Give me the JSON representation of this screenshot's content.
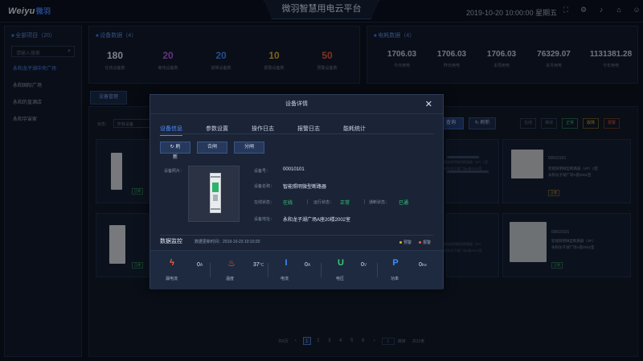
{
  "header": {
    "logo_text": "Weiyu",
    "logo_cn": "微羽",
    "title": "微羽智慧用电云平台",
    "datetime": "2019-10-20  10:00:00  星期五",
    "icons": [
      "fullscreen-icon",
      "settings-icon",
      "bell-icon",
      "home-icon",
      "user-icon"
    ]
  },
  "sidebar": {
    "title": "全部项目（20）",
    "search_placeholder": "请输入搜索",
    "items": [
      {
        "label": "永和龙子湖中央广场",
        "active": true
      },
      {
        "label": "永和国际广场",
        "active": false
      },
      {
        "label": "永和的皇酒店",
        "active": false
      },
      {
        "label": "永和宇宙家",
        "active": false
      }
    ]
  },
  "device_panel": {
    "title": "设备数据（4）",
    "stats": [
      {
        "value": "180",
        "label": "在线设备数",
        "color": "#e6edf7"
      },
      {
        "value": "20",
        "label": "离线设备数",
        "color": "#b45ee8"
      },
      {
        "value": "20",
        "label": "故障设备数",
        "color": "#3f8cff"
      },
      {
        "value": "10",
        "label": "报警设备数",
        "color": "#e7b22e"
      },
      {
        "value": "50",
        "label": "预警设备数",
        "color": "#ef5e3f"
      }
    ]
  },
  "energy_panel": {
    "title": "电耗数据（4）",
    "stats": [
      {
        "value": "1706.03",
        "label": "今日用电"
      },
      {
        "value": "1706.03",
        "label": "昨日用电"
      },
      {
        "value": "1706.03",
        "label": "本周用电"
      },
      {
        "value": "76329.07",
        "label": "本月用电"
      },
      {
        "value": "1131381.28",
        "label": "今年用电"
      }
    ]
  },
  "list": {
    "tab_label": "设备管理",
    "filter_label": "状态：",
    "filter_value": "所有设备",
    "refresh_label": "刷新",
    "query_label": "查询",
    "status_pills": [
      "在线",
      "离线",
      "正常",
      "故障",
      "报警"
    ],
    "card_ids": [
      "00010101",
      "00010101"
    ],
    "card_desc": [
      "智能照明微型断路器（4P）2室",
      "永和龙子湖广场A座2002室",
      "智能照明微型断路器（3P）",
      "永和龙子湖广场A座2002室"
    ],
    "card_badges": [
      "正常",
      "正常",
      "正常",
      "正常",
      "正常"
    ]
  },
  "pager": {
    "total_label": "共8页",
    "prev": "‹",
    "pages": [
      "1",
      "2",
      "3",
      "4",
      "5",
      "6"
    ],
    "next": "›",
    "goto_label": "跳转",
    "goto_value": "1",
    "count_label": "共32条"
  },
  "modal": {
    "title": "设备详情",
    "close": "✕",
    "tabs": [
      "设备信息",
      "参数设置",
      "操作日志",
      "报警日志",
      "能耗统计"
    ],
    "active_tab": 0,
    "buttons": {
      "refresh": "刷新",
      "close_switch": "合闸",
      "open_switch": "分闸"
    },
    "photo_label": "设备照片：",
    "info": {
      "device_no_label": "设备号：",
      "device_no": "00010101",
      "name_label": "设备名称：",
      "name": "智能照明微型断路器",
      "online_label": "在线状态：",
      "online": "在线",
      "run_label": "运行状态：",
      "run": "正常",
      "comm_label": "通断状态：",
      "comm": "已通",
      "addr_label": "设备地址：",
      "addr": "永和龙子湖广场A座20楼2002室"
    },
    "monitor": {
      "title": "数据监控",
      "update_label": "数据更新时间：",
      "update_time": "2019-10-23 10:10:20",
      "legend": [
        {
          "label": "预警",
          "color": "#e7b22e"
        },
        {
          "label": "报警",
          "color": "#ef5e3f"
        }
      ],
      "metrics": [
        {
          "icon": "lightning-icon",
          "glyph": "ϟ",
          "label": "漏电流",
          "value": "0",
          "unit": "A",
          "color": "#f0603c"
        },
        {
          "icon": "thermometer-icon",
          "glyph": "♨",
          "label": "温度",
          "value": "37",
          "unit": "°C",
          "color": "#f0603c"
        },
        {
          "icon": "current-icon",
          "glyph": "I",
          "label": "电流",
          "value": "0",
          "unit": "A",
          "color": "#3f8cff"
        },
        {
          "icon": "voltage-icon",
          "glyph": "U",
          "label": "电压",
          "value": "0",
          "unit": "V",
          "color": "#35c97a"
        },
        {
          "icon": "power-icon",
          "glyph": "P",
          "label": "功率",
          "value": "0",
          "unit": "kw",
          "color": "#3f8cff"
        }
      ]
    }
  }
}
